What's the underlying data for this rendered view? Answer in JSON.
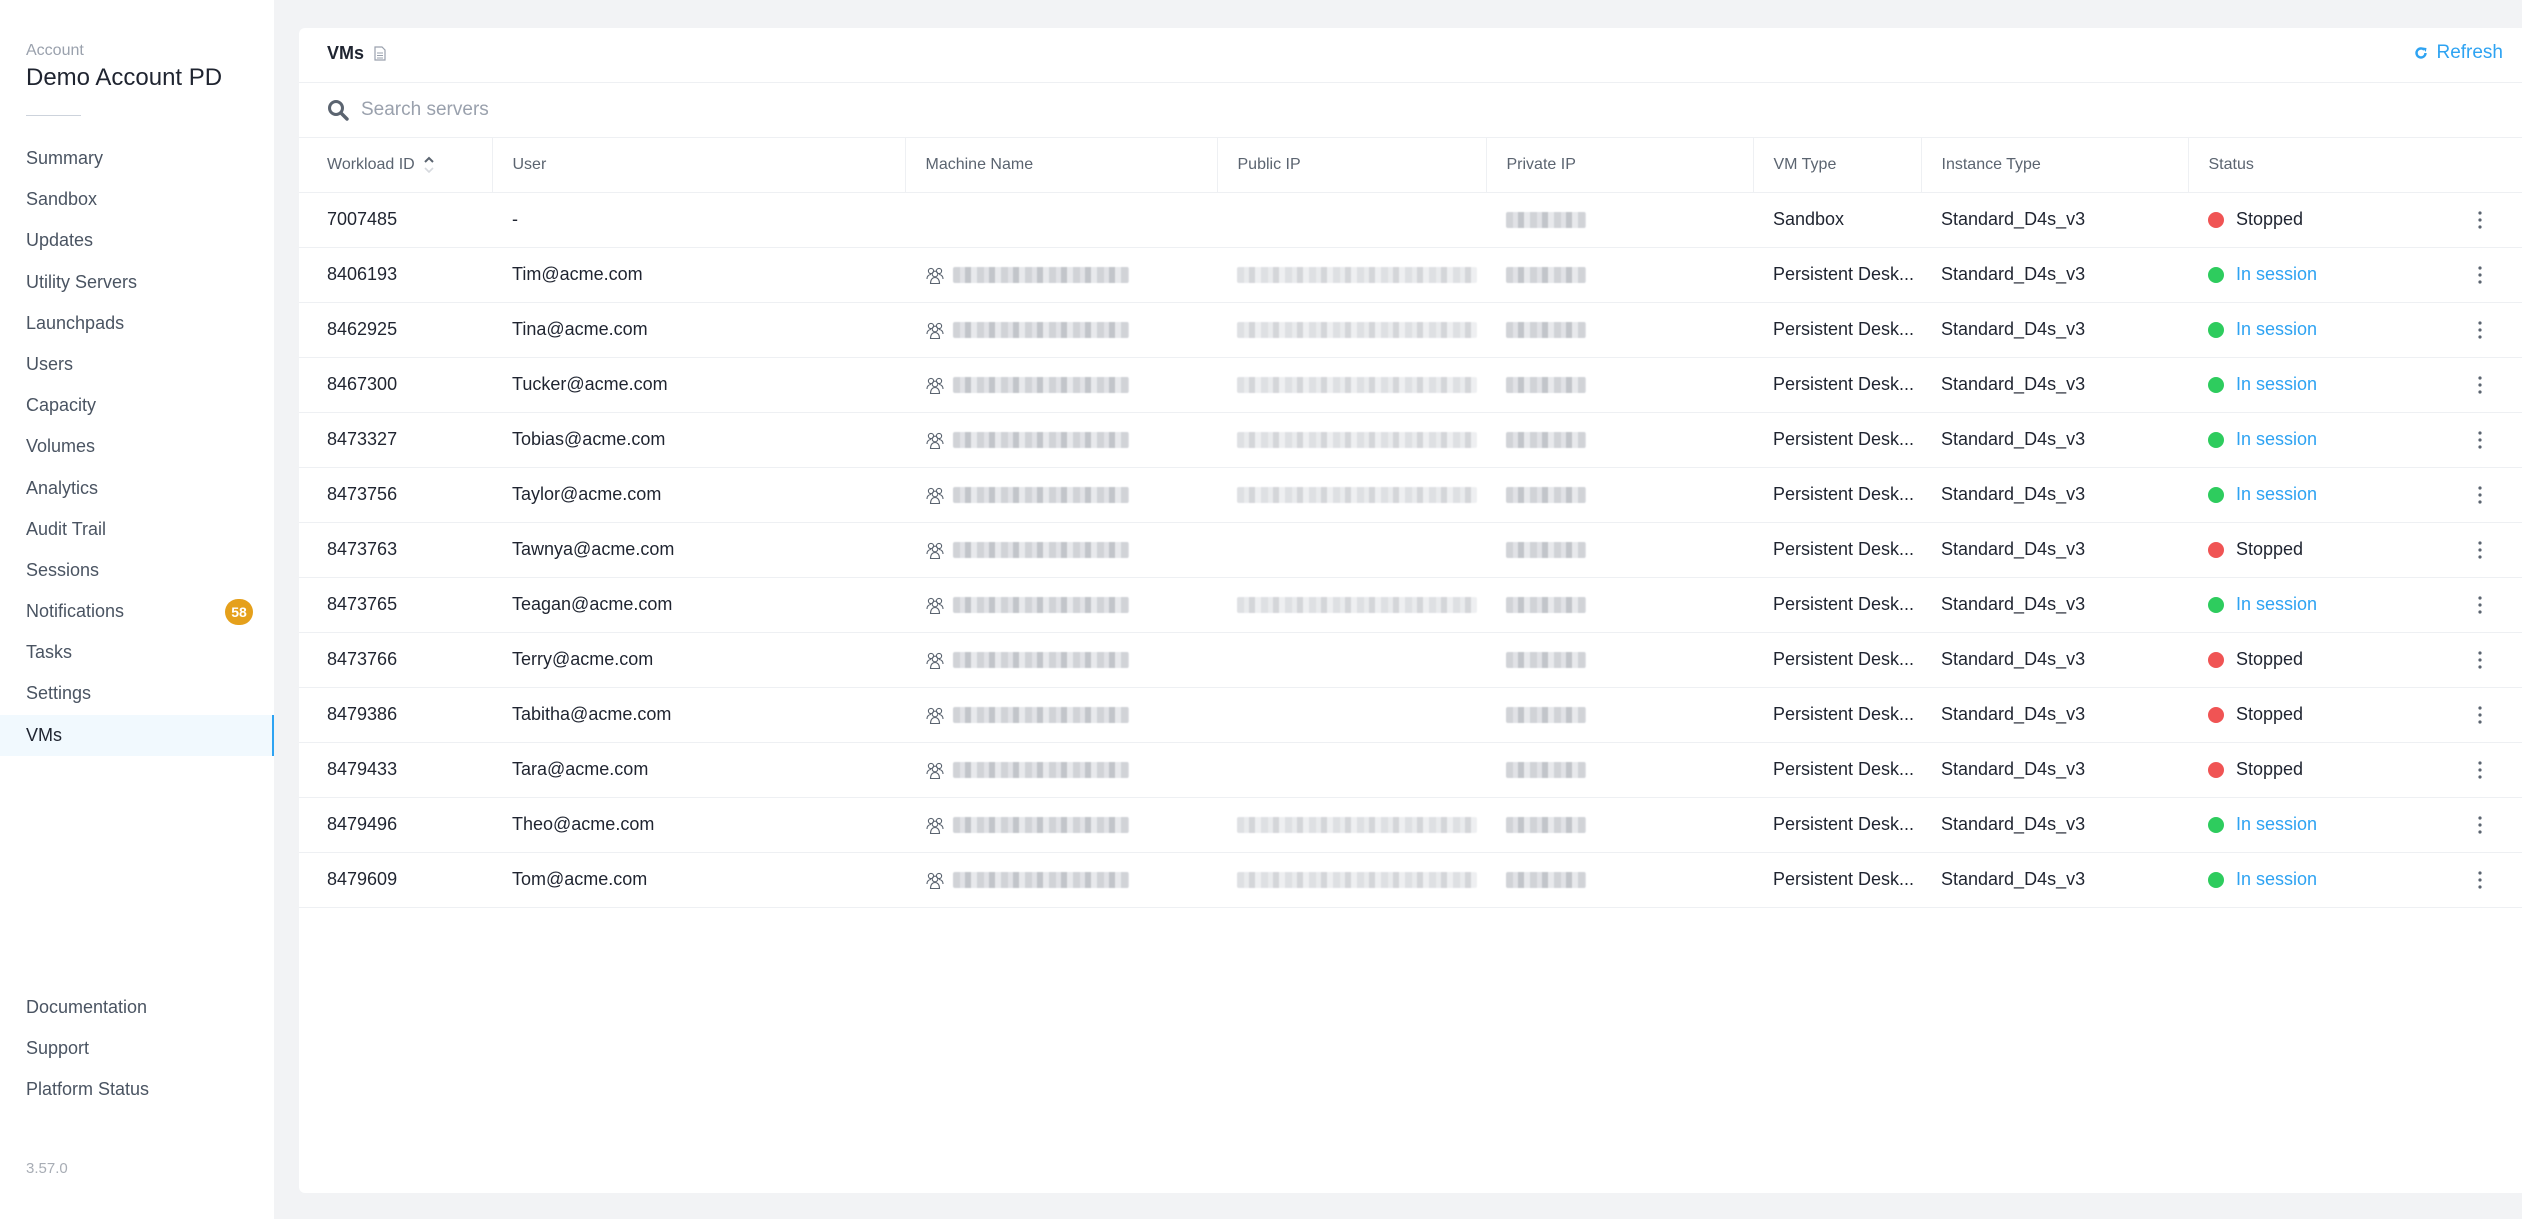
{
  "sidebar": {
    "account_label": "Account",
    "account_name": "Demo Account PD",
    "items": [
      {
        "label": "Summary"
      },
      {
        "label": "Sandbox"
      },
      {
        "label": "Updates"
      },
      {
        "label": "Utility Servers"
      },
      {
        "label": "Launchpads"
      },
      {
        "label": "Users"
      },
      {
        "label": "Capacity"
      },
      {
        "label": "Volumes"
      },
      {
        "label": "Analytics"
      },
      {
        "label": "Audit Trail"
      },
      {
        "label": "Sessions"
      },
      {
        "label": "Notifications",
        "badge": "58"
      },
      {
        "label": "Tasks"
      },
      {
        "label": "Settings"
      },
      {
        "label": "VMs",
        "active": true
      }
    ],
    "bottom_items": [
      {
        "label": "Documentation"
      },
      {
        "label": "Support"
      },
      {
        "label": "Platform Status"
      }
    ],
    "version": "3.57.0"
  },
  "card": {
    "title": "VMs",
    "title_icon": "document-icon",
    "refresh_label": "Refresh",
    "refresh_icon": "refresh-icon"
  },
  "search": {
    "placeholder": "Search servers",
    "value": "",
    "icon": "search-icon"
  },
  "table": {
    "columns": [
      {
        "label": "Workload ID",
        "sorted": "ascending"
      },
      {
        "label": "User"
      },
      {
        "label": "Machine Name"
      },
      {
        "label": "Public IP"
      },
      {
        "label": "Private IP"
      },
      {
        "label": "VM Type"
      },
      {
        "label": "Instance Type"
      },
      {
        "label": "Status"
      },
      {
        "label": ""
      }
    ],
    "rows": [
      {
        "workload_id": "7007485",
        "user": "-",
        "machine_name": "",
        "public_ip": "",
        "private_ip": "redacted",
        "vm_type": "Sandbox",
        "instance_type": "Standard_D4s_v3",
        "status": "Stopped"
      },
      {
        "workload_id": "8406193",
        "user": "Tim@acme.com",
        "machine_name": "redacted",
        "public_ip": "redacted",
        "private_ip": "redacted",
        "vm_type": "Persistent Desk...",
        "instance_type": "Standard_D4s_v3",
        "status": "In session"
      },
      {
        "workload_id": "8462925",
        "user": "Tina@acme.com",
        "machine_name": "redacted",
        "public_ip": "redacted",
        "private_ip": "redacted",
        "vm_type": "Persistent Desk...",
        "instance_type": "Standard_D4s_v3",
        "status": "In session"
      },
      {
        "workload_id": "8467300",
        "user": "Tucker@acme.com",
        "machine_name": "redacted",
        "public_ip": "redacted",
        "private_ip": "redacted",
        "vm_type": "Persistent Desk...",
        "instance_type": "Standard_D4s_v3",
        "status": "In session"
      },
      {
        "workload_id": "8473327",
        "user": "Tobias@acme.com",
        "machine_name": "redacted",
        "public_ip": "redacted",
        "private_ip": "redacted",
        "vm_type": "Persistent Desk...",
        "instance_type": "Standard_D4s_v3",
        "status": "In session"
      },
      {
        "workload_id": "8473756",
        "user": "Taylor@acme.com",
        "machine_name": "redacted",
        "public_ip": "redacted",
        "private_ip": "redacted",
        "vm_type": "Persistent Desk...",
        "instance_type": "Standard_D4s_v3",
        "status": "In session"
      },
      {
        "workload_id": "8473763",
        "user": "Tawnya@acme.com",
        "machine_name": "redacted",
        "public_ip": "",
        "private_ip": "redacted",
        "vm_type": "Persistent Desk...",
        "instance_type": "Standard_D4s_v3",
        "status": "Stopped"
      },
      {
        "workload_id": "8473765",
        "user": "Teagan@acme.com",
        "machine_name": "redacted",
        "public_ip": "redacted",
        "private_ip": "redacted",
        "vm_type": "Persistent Desk...",
        "instance_type": "Standard_D4s_v3",
        "status": "In session"
      },
      {
        "workload_id": "8473766",
        "user": "Terry@acme.com",
        "machine_name": "redacted",
        "public_ip": "",
        "private_ip": "redacted",
        "vm_type": "Persistent Desk...",
        "instance_type": "Standard_D4s_v3",
        "status": "Stopped"
      },
      {
        "workload_id": "8479386",
        "user": "Tabitha@acme.com",
        "machine_name": "redacted",
        "public_ip": "",
        "private_ip": "redacted",
        "vm_type": "Persistent Desk...",
        "instance_type": "Standard_D4s_v3",
        "status": "Stopped"
      },
      {
        "workload_id": "8479433",
        "user": "Tara@acme.com",
        "machine_name": "redacted",
        "public_ip": "",
        "private_ip": "redacted",
        "vm_type": "Persistent Desk...",
        "instance_type": "Standard_D4s_v3",
        "status": "Stopped"
      },
      {
        "workload_id": "8479496",
        "user": "Theo@acme.com",
        "machine_name": "redacted",
        "public_ip": "redacted",
        "private_ip": "redacted",
        "vm_type": "Persistent Desk...",
        "instance_type": "Standard_D4s_v3",
        "status": "In session"
      },
      {
        "workload_id": "8479609",
        "user": "Tom@acme.com",
        "machine_name": "redacted",
        "public_ip": "redacted",
        "private_ip": "redacted",
        "vm_type": "Persistent Desk...",
        "instance_type": "Standard_D4s_v3",
        "status": "In session"
      }
    ]
  },
  "colors": {
    "accent": "#2ea3f2",
    "status_stopped": "#f05454",
    "status_in_session": "#2ecc5e",
    "badge": "#e5a01b",
    "page_bg": "#f2f3f5"
  }
}
